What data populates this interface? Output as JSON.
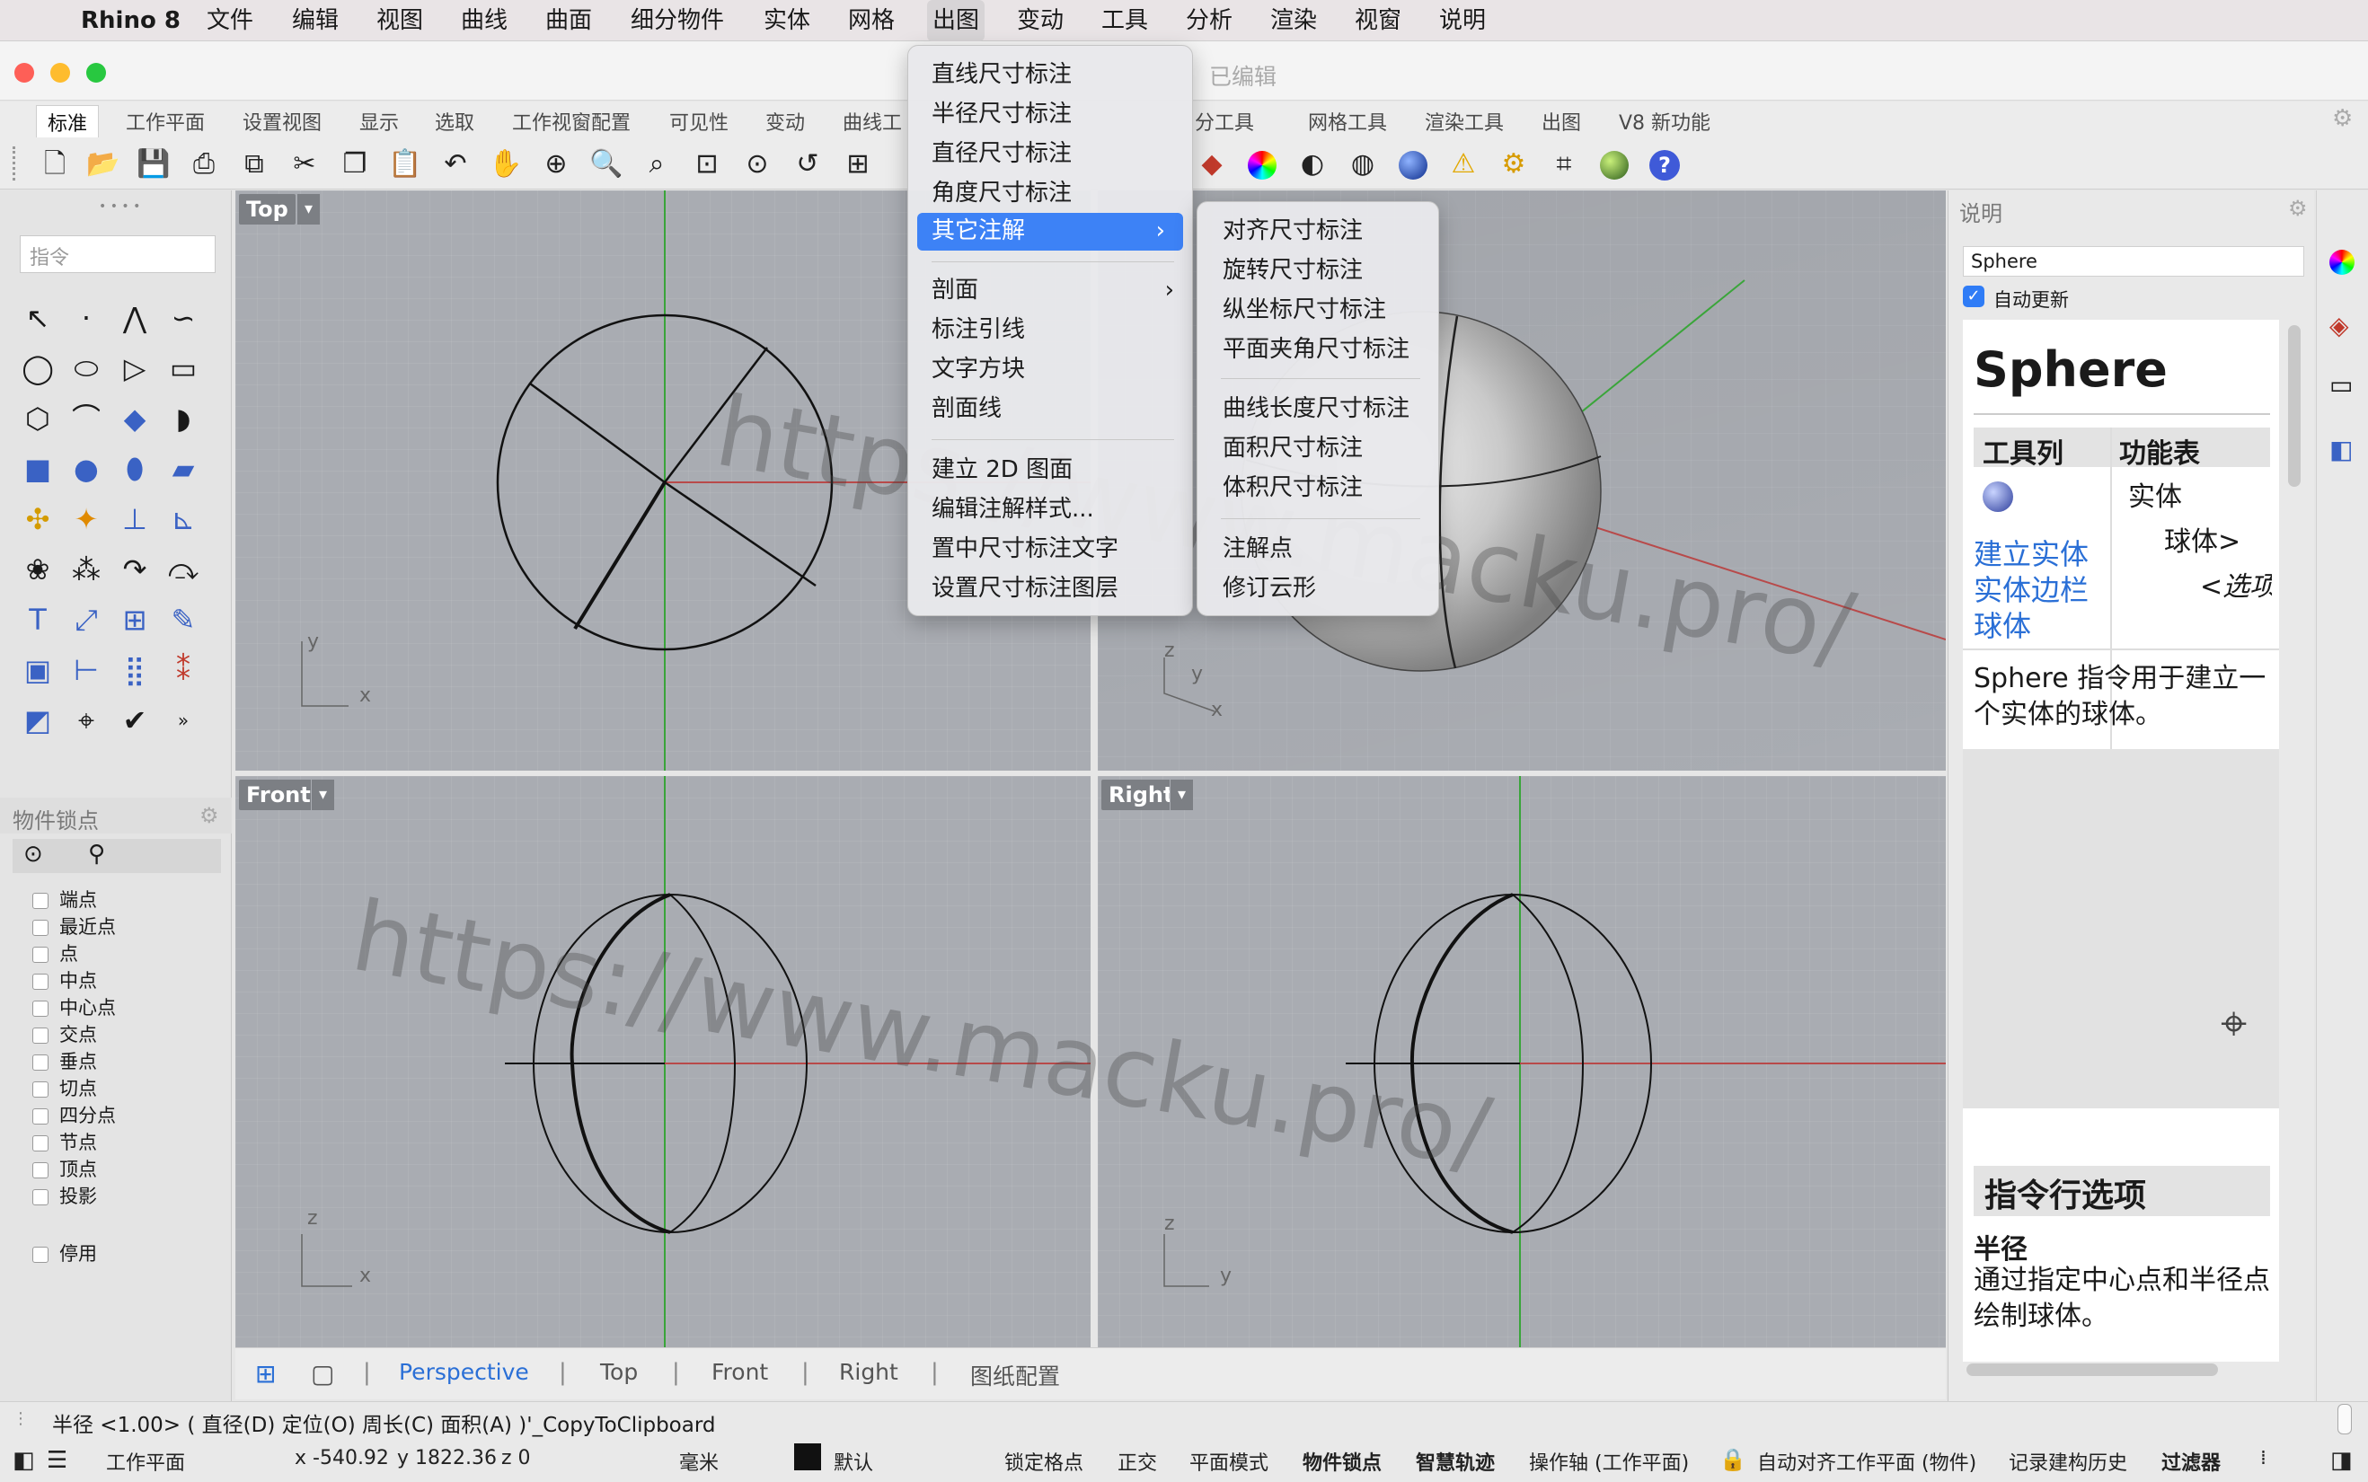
{
  "menubar": {
    "app": "Rhino 8",
    "items": [
      "文件",
      "编辑",
      "视图",
      "曲线",
      "曲面",
      "细分物件",
      "实体",
      "网格",
      "出图",
      "变动",
      "工具",
      "分析",
      "渲染",
      "视窗",
      "说明"
    ],
    "open": "出图"
  },
  "window": {
    "title": "已编辑"
  },
  "tabs": [
    "标准",
    "工作平面",
    "设置视图",
    "显示",
    "选取",
    "工作视窗配置",
    "可见性",
    "变动",
    "曲线工",
    "分工具",
    "网格工具",
    "渲染工具",
    "出图",
    "V8 新功能"
  ],
  "command": {
    "placeholder": "指令"
  },
  "viewports": {
    "top": "Top",
    "perspective": "Perspective",
    "front": "Front",
    "right": "Right"
  },
  "axes": {
    "x": "x",
    "y": "y",
    "z": "z"
  },
  "osnap": {
    "title": "物件锁点",
    "items": [
      "端点",
      "最近点",
      "点",
      "中点",
      "中心点",
      "交点",
      "垂点",
      "切点",
      "四分点",
      "节点",
      "顶点",
      "投影"
    ],
    "disable": "停用"
  },
  "vptabs": [
    "Perspective",
    "Top",
    "Front",
    "Right",
    "图纸配置"
  ],
  "help": {
    "title": "说明",
    "search": "Sphere",
    "auto_update": "自动更新",
    "heading": "Sphere",
    "col_toolbar": "工具列",
    "col_function": "功能表",
    "func1": "实体",
    "func2": "球体>",
    "func3": "<选项",
    "links": [
      "建立实体",
      "实体边栏",
      "球体"
    ],
    "desc": "Sphere 指令用于建立一个实体的球体。",
    "options_heading": "指令行选项",
    "opt_name": "半径",
    "opt_desc": "通过指定中心点和半径点绘制球体。"
  },
  "dimension_menu": {
    "items": [
      "直线尺寸标注",
      "半径尺寸标注",
      "直径尺寸标注",
      "角度尺寸标注",
      "其它注解",
      "剖面",
      "标注引线",
      "文字方块",
      "剖面线",
      "建立 2D 图面",
      "编辑注解样式...",
      "置中尺寸标注文字",
      "设置尺寸标注图层"
    ],
    "highlighted": "其它注解"
  },
  "submenu": {
    "items": [
      "对齐尺寸标注",
      "旋转尺寸标注",
      "纵坐标尺寸标注",
      "平面夹角尺寸标注",
      "曲线长度尺寸标注",
      "面积尺寸标注",
      "体积尺寸标注",
      "注解点",
      "修订云形"
    ]
  },
  "status": {
    "prompt": "半径 <1.00> ( 直径(D) 定位(O) 周长(C) 面积(A) )'_CopyToClipboard",
    "cplane": "工作平面",
    "x": "x -540.92",
    "y": "y 1822.36",
    "z": "z 0",
    "units": "毫米",
    "layer": "默认",
    "toggles": [
      "锁定格点",
      "正交",
      "平面模式",
      "物件锁点",
      "智慧轨迹",
      "操作轴 (工作平面)",
      "自动对齐工作平面 (物件)",
      "记录建构历史",
      "过滤器"
    ],
    "bold_toggles": [
      "物件锁点",
      "智慧轨迹",
      "过滤器"
    ]
  },
  "watermark": "https://www.macku.pro/",
  "colors": {
    "viewport": "#a9acb2",
    "highlight": "#3d82f6",
    "link": "#2a6fd6"
  }
}
